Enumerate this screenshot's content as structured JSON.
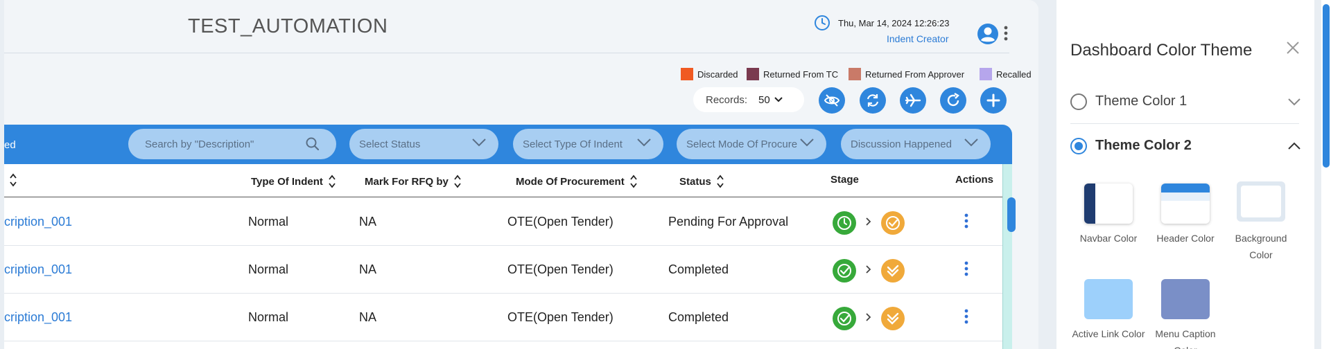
{
  "header": {
    "app_title": "TEST_AUTOMATION",
    "datetime": "Thu, Mar 14, 2024 12:26:23",
    "role": "Indent Creator"
  },
  "legend": [
    {
      "label": "Discarded",
      "color": "#f05a22"
    },
    {
      "label": "Returned From TC",
      "color": "#7a3a4f"
    },
    {
      "label": "Returned From Approver",
      "color": "#c97a68"
    },
    {
      "label": "Recalled",
      "color": "#b6a6ec"
    }
  ],
  "records": {
    "label": "Records:",
    "value": "50"
  },
  "actions": {
    "icons": [
      "eye-off-icon",
      "sync-icon",
      "airplane-icon",
      "refresh-icon",
      "plus-icon"
    ]
  },
  "filter_bar": {
    "cut_label": "ed",
    "search_placeholder": "Search by \"Description\"",
    "status_placeholder": "Select Status",
    "indent_type_placeholder": "Select Type Of Indent",
    "procure_mode_placeholder": "Select Mode Of Procure",
    "discussion_placeholder": "Discussion Happened"
  },
  "table": {
    "columns": {
      "type_of_indent": "Type Of Indent",
      "mark_for_rfq": "Mark For RFQ by",
      "mode_of_procurement": "Mode Of Procurement",
      "status": "Status",
      "stage": "Stage",
      "actions": "Actions"
    },
    "rows": [
      {
        "description": "cription_001",
        "type": "Normal",
        "rfq": "NA",
        "mode": "OTE(Open Tender)",
        "status": "Pending For Approval",
        "stage1": "pending",
        "stage2": "approved"
      },
      {
        "description": "cription_001",
        "type": "Normal",
        "rfq": "NA",
        "mode": "OTE(Open Tender)",
        "status": "Completed",
        "stage1": "completed",
        "stage2": "double-check"
      },
      {
        "description": "cription_001",
        "type": "Normal",
        "rfq": "NA",
        "mode": "OTE(Open Tender)",
        "status": "Completed",
        "stage1": "completed",
        "stage2": "double-check"
      }
    ]
  },
  "panel": {
    "title": "Dashboard Color Theme",
    "theme1": "Theme Color 1",
    "theme2": "Theme Color 2",
    "selected_theme": "Theme Color 2",
    "swatches": [
      {
        "label": "Navbar Color"
      },
      {
        "label": "Header Color"
      },
      {
        "label": "Background Color"
      },
      {
        "label": "Active Link Color"
      },
      {
        "label": "Menu Caption Color"
      }
    ],
    "colors": {
      "navbar": "#1f3c70",
      "header": "#2f86dd",
      "background": "#dfe8f1",
      "active_link": "#9dd0fb",
      "menu_caption": "#7a8fc7"
    }
  },
  "colors": {
    "accent": "#2f86dd",
    "stage_green": "#37a93a",
    "stage_orange": "#f0a93a",
    "link": "#2b7bd5"
  }
}
